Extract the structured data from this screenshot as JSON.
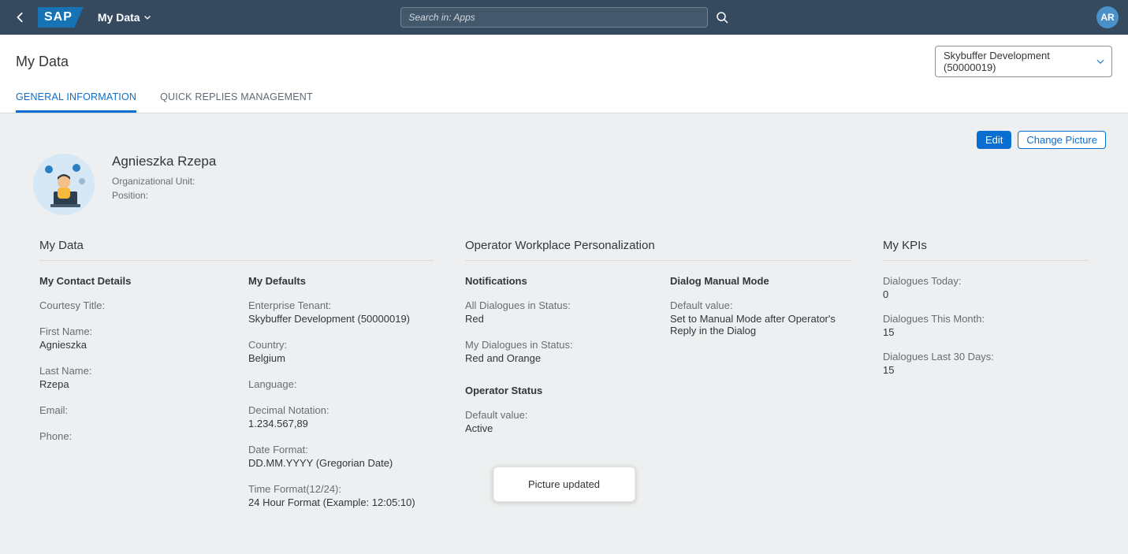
{
  "header": {
    "logo_text": "SAP",
    "app_title": "My Data",
    "search_placeholder": "Search in: Apps",
    "avatar_initials": "AR"
  },
  "subheader": {
    "page_title": "My Data",
    "tenant_selected": "Skybuffer Development (50000019)",
    "tabs": [
      {
        "label": "GENERAL INFORMATION",
        "active": true
      },
      {
        "label": "QUICK REPLIES MANAGEMENT",
        "active": false
      }
    ]
  },
  "actions": {
    "edit": "Edit",
    "change_picture": "Change Picture"
  },
  "profile": {
    "full_name": "Agnieszka Rzepa",
    "org_unit_label": "Organizational Unit:",
    "org_unit_value": "",
    "position_label": "Position:",
    "position_value": ""
  },
  "mydata": {
    "title": "My Data",
    "contact": {
      "heading": "My Contact Details",
      "courtesy_title_label": "Courtesy Title:",
      "courtesy_title_value": "",
      "first_name_label": "First Name:",
      "first_name_value": "Agnieszka",
      "last_name_label": "Last Name:",
      "last_name_value": "Rzepa",
      "email_label": "Email:",
      "email_value": "",
      "phone_label": "Phone:",
      "phone_value": ""
    },
    "defaults": {
      "heading": "My Defaults",
      "tenant_label": "Enterprise Tenant:",
      "tenant_value": "Skybuffer Development (50000019)",
      "country_label": "Country:",
      "country_value": "Belgium",
      "language_label": "Language:",
      "language_value": "",
      "decimal_label": "Decimal Notation:",
      "decimal_value": "1.234.567,89",
      "date_label": "Date Format:",
      "date_value": "DD.MM.YYYY (Gregorian Date)",
      "time_label": "Time Format(12/24):",
      "time_value": "24 Hour Format (Example: 12:05:10)"
    }
  },
  "personalization": {
    "title": "Operator Workplace Personalization",
    "notifications": {
      "heading": "Notifications",
      "all_label": "All Dialogues in Status:",
      "all_value": "Red",
      "my_label": "My Dialogues in Status:",
      "my_value": "Red and Orange"
    },
    "operator_status": {
      "heading": "Operator Status",
      "default_label": "Default value:",
      "default_value": "Active"
    },
    "dialog_manual": {
      "heading": "Dialog Manual Mode",
      "default_label": "Default value:",
      "default_value": "Set to Manual Mode after Operator's Reply in the Dialog"
    }
  },
  "kpi": {
    "title": "My KPIs",
    "items": [
      {
        "label": "Dialogues Today:",
        "value": "0"
      },
      {
        "label": "Dialogues This Month:",
        "value": "15"
      },
      {
        "label": "Dialogues Last 30 Days:",
        "value": "15"
      }
    ]
  },
  "toast": {
    "message": "Picture updated"
  }
}
